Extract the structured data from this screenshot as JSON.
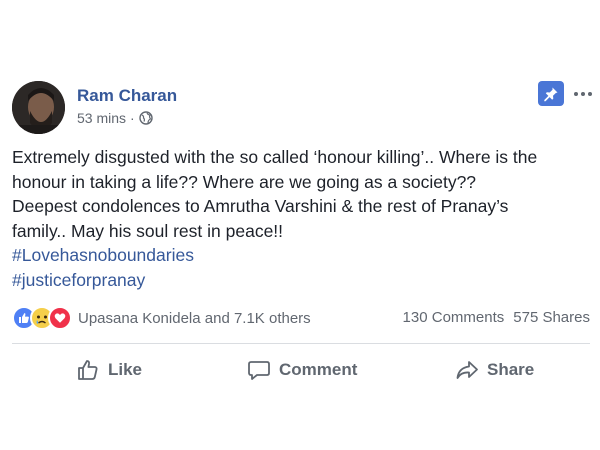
{
  "post": {
    "author": "Ram Charan",
    "time": "53 mins",
    "separator": "·",
    "audience_icon": "globe-icon",
    "pin_icon": "pin-icon",
    "more_icon": "more-icon",
    "text_lines": [
      "Extremely disgusted with the so called ‘honour killing’.. Where is the",
      "honour in taking a life?? Where are we going as a society??",
      "Deepest condolences to Amrutha Varshini & the rest of Pranay’s",
      "family.. May his soul rest in peace!!"
    ],
    "hashtags": [
      "#Lovehasnoboundaries",
      "#justiceforpranay"
    ]
  },
  "reactions": {
    "icons": [
      "like-reaction-icon",
      "sad-reaction-icon",
      "love-reaction-icon"
    ],
    "names": "Upasana Konidela and 7.1K others",
    "comments": "130 Comments",
    "shares": "575 Shares"
  },
  "actions": {
    "like": "Like",
    "comment": "Comment",
    "share": "Share"
  },
  "colors": {
    "link": "#365899",
    "text": "#1d2129",
    "muted": "#616770",
    "pin_bg": "#4a76d6"
  }
}
